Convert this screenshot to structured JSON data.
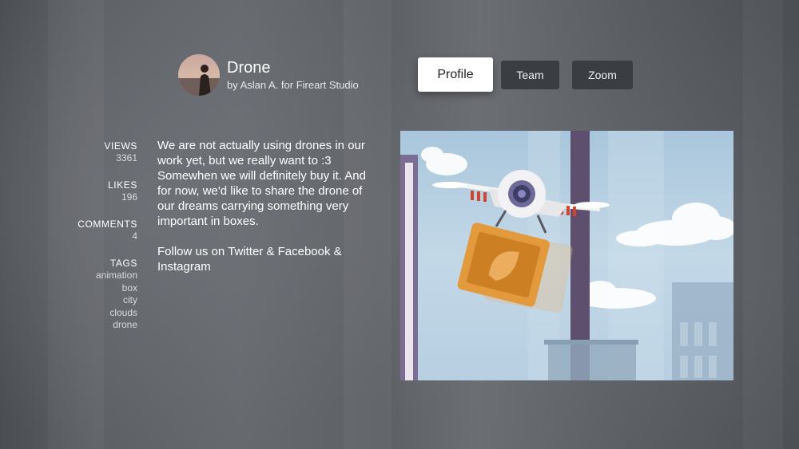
{
  "shot": {
    "title": "Drone",
    "byline": "by Aslan A. for Fireart Studio"
  },
  "buttons": {
    "profile": "Profile",
    "team": "Team",
    "zoom": "Zoom"
  },
  "stats": {
    "views_label": "VIEWS",
    "views_value": "3361",
    "likes_label": "LIKES",
    "likes_value": "196",
    "comments_label": "COMMENTS",
    "comments_value": "4",
    "tags_label": "TAGS",
    "tags": [
      "animation",
      "box",
      "city",
      "clouds",
      "drone"
    ]
  },
  "description": {
    "paragraph1": "We are not actually using drones in our work yet, but we really want to :3 Somewhen we will definitely buy it. And for now, we'd like to share the drone of our dreams carrying something very important in boxes.",
    "paragraph2": "Follow us on Twitter & Facebook & Instagram"
  },
  "colors": {
    "accent_button_bg": "#ffffff",
    "secondary_button_bg": "#3a3d42",
    "box_orange": "#e39a3c",
    "sky_blue": "#bcd3e4"
  }
}
